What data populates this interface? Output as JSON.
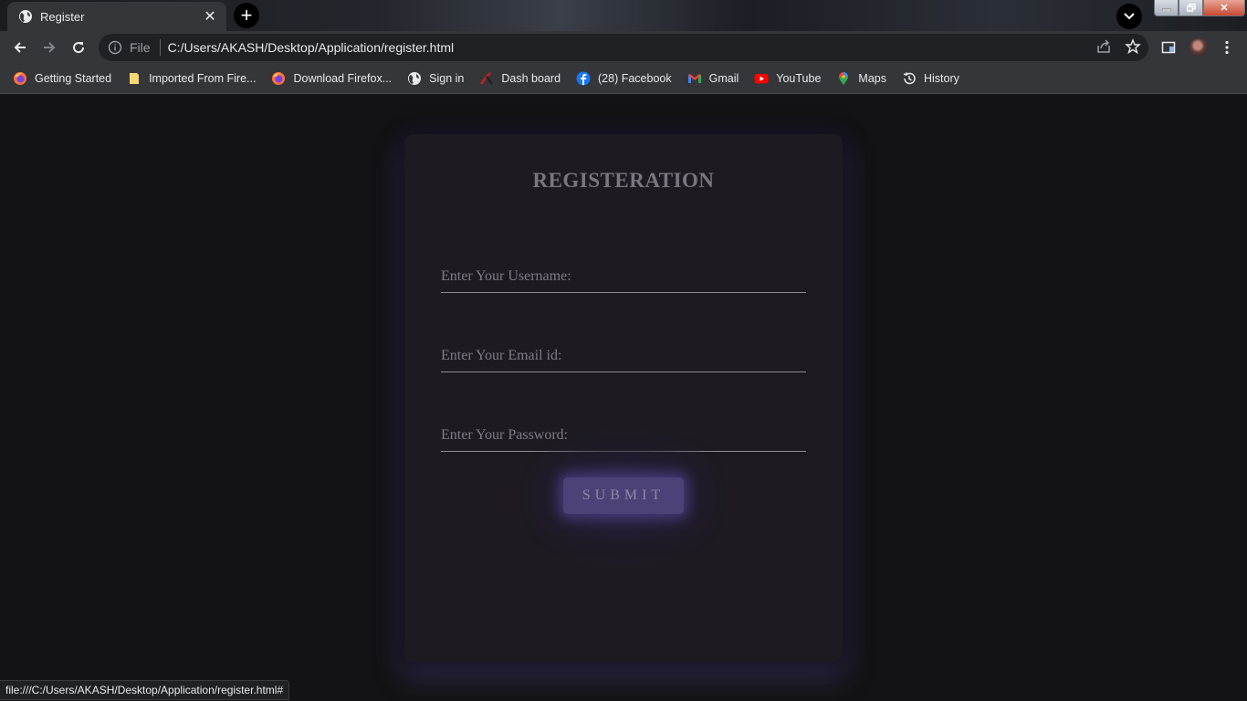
{
  "browser": {
    "tab_title": "Register",
    "address_scheme": "File",
    "address_url": "C:/Users/AKASH/Desktop/Application/register.html",
    "status_url": "file:///C:/Users/AKASH/Desktop/Application/register.html#"
  },
  "bookmarks": [
    {
      "label": "Getting Started",
      "icon": "firefox-icon"
    },
    {
      "label": "Imported From Fire...",
      "icon": "folder-icon"
    },
    {
      "label": "Download Firefox...",
      "icon": "firefox-icon"
    },
    {
      "label": "Sign in",
      "icon": "globe-icon"
    },
    {
      "label": "Dash board",
      "icon": "dashboard-icon"
    },
    {
      "label": "(28) Facebook",
      "icon": "facebook-icon"
    },
    {
      "label": "Gmail",
      "icon": "gmail-icon"
    },
    {
      "label": "YouTube",
      "icon": "youtube-icon"
    },
    {
      "label": "Maps",
      "icon": "maps-icon"
    },
    {
      "label": "History",
      "icon": "history-icon"
    }
  ],
  "form": {
    "title": "REGISTERATION",
    "username_placeholder": "Enter Your Username:",
    "email_placeholder": "Enter Your Email id:",
    "password_placeholder": "Enter Your Password:",
    "submit_label": "SUBMIT"
  },
  "colors": {
    "card_background": "#1d1b21",
    "submit_background": "#4d4277",
    "glow": "#6e5ac8"
  }
}
